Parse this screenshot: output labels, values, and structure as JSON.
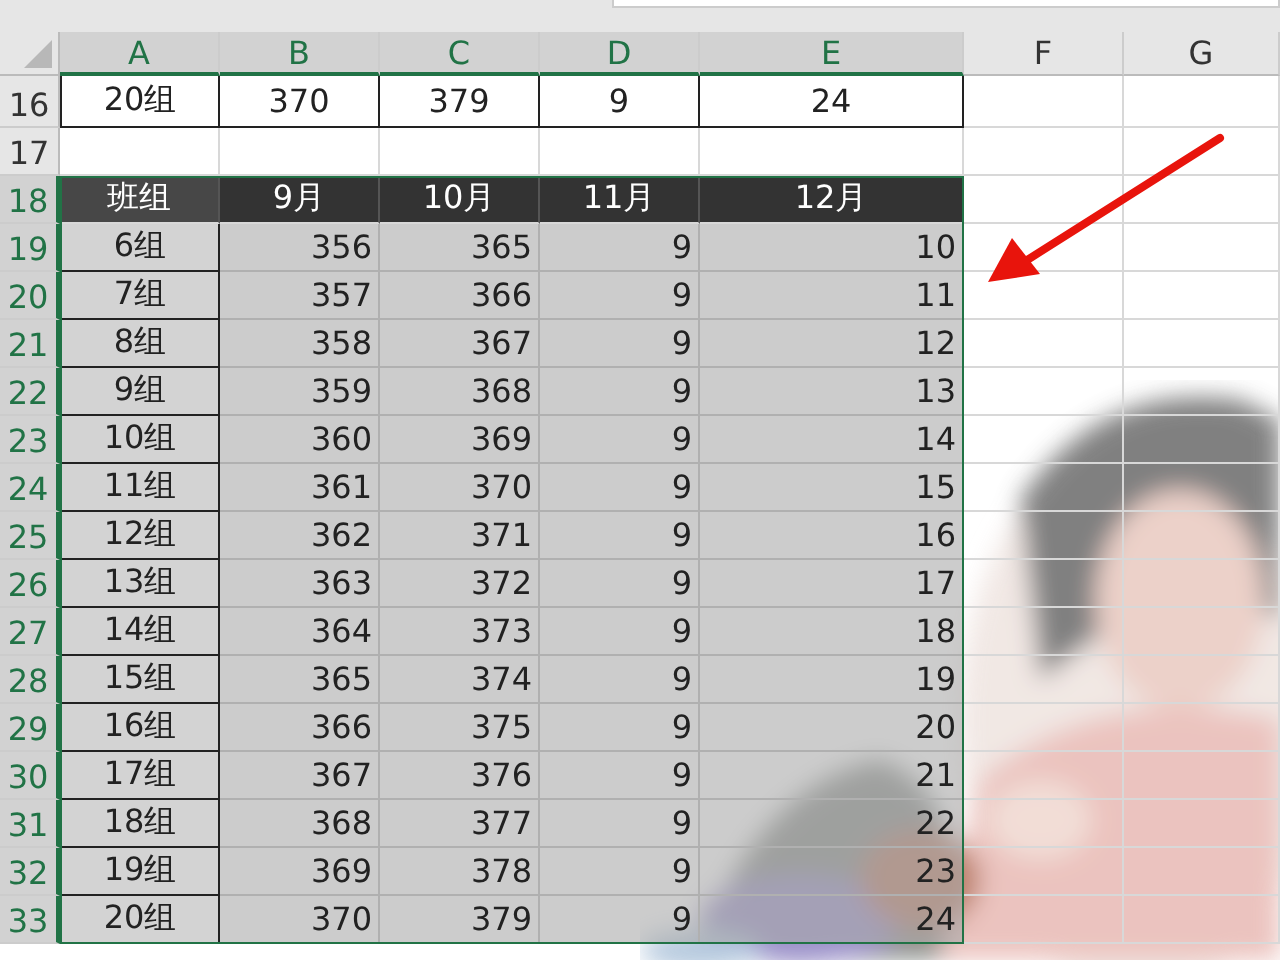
{
  "column_headers": [
    {
      "label": "A",
      "selected": true
    },
    {
      "label": "B",
      "selected": true
    },
    {
      "label": "C",
      "selected": true
    },
    {
      "label": "D",
      "selected": true
    },
    {
      "label": "E",
      "selected": true
    },
    {
      "label": "F",
      "selected": false
    },
    {
      "label": "G",
      "selected": false
    }
  ],
  "rows": [
    {
      "number": "16",
      "selected": false,
      "kind": "plain",
      "cells": [
        "20组",
        "370",
        "379",
        "9",
        "24"
      ]
    },
    {
      "number": "17",
      "selected": false,
      "kind": "blank"
    },
    {
      "number": "18",
      "selected": true,
      "kind": "header",
      "cells": [
        "班组",
        "9月",
        "10月",
        "11月",
        "12月"
      ]
    },
    {
      "number": "19",
      "selected": true,
      "kind": "data",
      "cells": [
        "6组",
        "356",
        "365",
        "9",
        "10"
      ]
    },
    {
      "number": "20",
      "selected": true,
      "kind": "data",
      "cells": [
        "7组",
        "357",
        "366",
        "9",
        "11"
      ]
    },
    {
      "number": "21",
      "selected": true,
      "kind": "data",
      "cells": [
        "8组",
        "358",
        "367",
        "9",
        "12"
      ]
    },
    {
      "number": "22",
      "selected": true,
      "kind": "data",
      "cells": [
        "9组",
        "359",
        "368",
        "9",
        "13"
      ]
    },
    {
      "number": "23",
      "selected": true,
      "kind": "data",
      "cells": [
        "10组",
        "360",
        "369",
        "9",
        "14"
      ]
    },
    {
      "number": "24",
      "selected": true,
      "kind": "data",
      "cells": [
        "11组",
        "361",
        "370",
        "9",
        "15"
      ]
    },
    {
      "number": "25",
      "selected": true,
      "kind": "data",
      "cells": [
        "12组",
        "362",
        "371",
        "9",
        "16"
      ]
    },
    {
      "number": "26",
      "selected": true,
      "kind": "data",
      "cells": [
        "13组",
        "363",
        "372",
        "9",
        "17"
      ]
    },
    {
      "number": "27",
      "selected": true,
      "kind": "data",
      "cells": [
        "14组",
        "364",
        "373",
        "9",
        "18"
      ]
    },
    {
      "number": "28",
      "selected": true,
      "kind": "data",
      "cells": [
        "15组",
        "365",
        "374",
        "9",
        "19"
      ]
    },
    {
      "number": "29",
      "selected": true,
      "kind": "data",
      "cells": [
        "16组",
        "366",
        "375",
        "9",
        "20"
      ]
    },
    {
      "number": "30",
      "selected": true,
      "kind": "data",
      "cells": [
        "17组",
        "367",
        "376",
        "9",
        "21"
      ]
    },
    {
      "number": "31",
      "selected": true,
      "kind": "data",
      "cells": [
        "18组",
        "368",
        "377",
        "9",
        "22"
      ]
    },
    {
      "number": "32",
      "selected": true,
      "kind": "data",
      "cells": [
        "19组",
        "369",
        "378",
        "9",
        "23"
      ]
    },
    {
      "number": "33",
      "selected": true,
      "kind": "data",
      "cells": [
        "20组",
        "370",
        "379",
        "9",
        "24"
      ]
    }
  ]
}
